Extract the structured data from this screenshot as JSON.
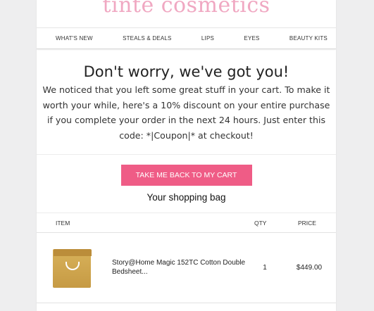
{
  "brand": {
    "logo_text": "tinte cosmetics"
  },
  "nav": {
    "items": [
      "WHAT'S NEW",
      "STEALS & DEALS",
      "LIPS",
      "EYES",
      "BEAUTY KITS"
    ]
  },
  "hero": {
    "heading": "Don't worry, we've got you!",
    "body": "We noticed that you left some great stuff in your cart. To make it worth your while, here's a 10% discount on your entire purchase if you complete your order in the next 24 hours. Just enter this code: *|Coupon|* at checkout!"
  },
  "cta": {
    "label": "TAKE ME BACK TO MY CART"
  },
  "bag": {
    "title": "Your shopping bag",
    "columns": {
      "item": "ITEM",
      "qty": "QTY",
      "price": "PRICE"
    },
    "items": [
      {
        "name": "Story@Home Magic 152TC Cotton Double Bedsheet...",
        "qty": "1",
        "price": "$449.00",
        "thumbnail_icon": "shopping-bag-icon"
      }
    ]
  },
  "colors": {
    "accent": "#ef5c86",
    "logo": "#f0a8c2",
    "bag_thumb": "#d2aa55"
  }
}
